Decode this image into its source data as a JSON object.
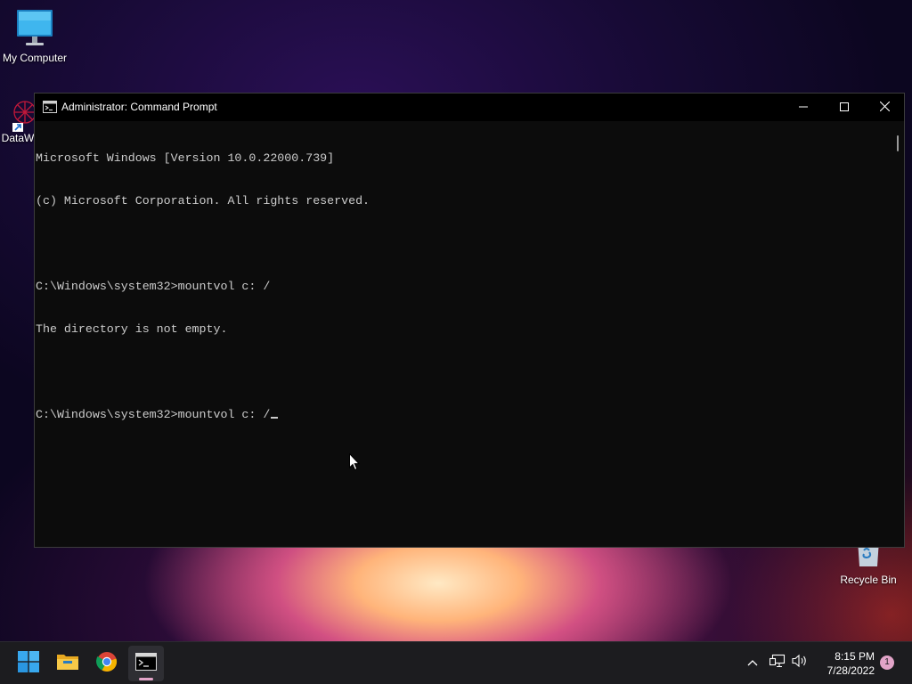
{
  "desktop": {
    "icons": [
      {
        "label": "My Computer",
        "icon": "monitor-icon"
      },
      {
        "label": "DataW",
        "icon": "datawrapper-shortcut-icon"
      },
      {
        "label": "Recycle Bin",
        "icon": "recycle-bin-icon"
      }
    ]
  },
  "window": {
    "title": "Administrator: Command Prompt",
    "icon": "cmd-icon",
    "controls": {
      "minimize": "minimize-icon",
      "maximize": "maximize-icon",
      "close": "close-icon"
    }
  },
  "console": {
    "lines": [
      "Microsoft Windows [Version 10.0.22000.739]",
      "(c) Microsoft Corporation. All rights reserved.",
      "",
      "C:\\Windows\\system32>mountvol c: /",
      "The directory is not empty.",
      "",
      "C:\\Windows\\system32>mountvol c: /"
    ],
    "text_color": "#cccccc",
    "background": "#0c0c0c"
  },
  "taskbar": {
    "apps": [
      {
        "name": "Start",
        "icon": "windows-start-icon"
      },
      {
        "name": "File Explorer",
        "icon": "folder-icon"
      },
      {
        "name": "Google Chrome",
        "icon": "chrome-icon"
      },
      {
        "name": "Command Prompt",
        "icon": "cmd-icon",
        "active": true
      }
    ],
    "tray": {
      "chevron": "chevron-up-icon",
      "network": "network-icon",
      "volume": "speaker-icon"
    },
    "clock": {
      "time": "8:15 PM",
      "date": "7/28/2022"
    },
    "notification_count": "1",
    "accent": "#e2a4c8"
  }
}
